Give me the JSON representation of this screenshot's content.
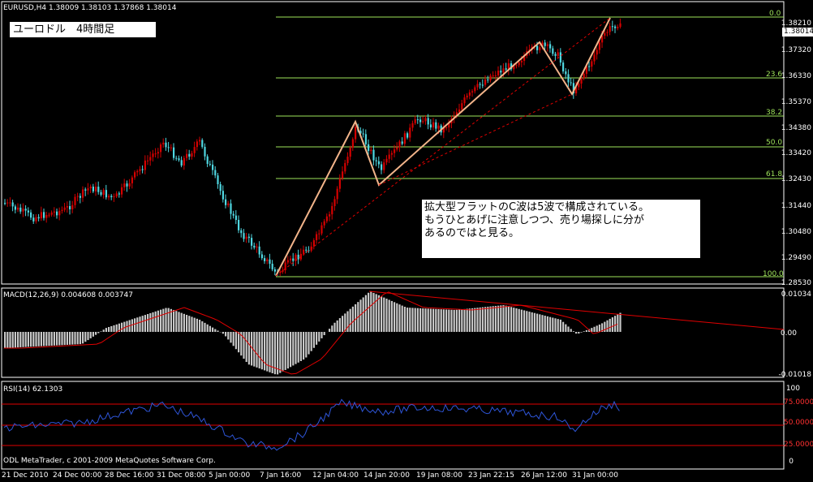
{
  "symbol_header": "EURUSD,H4  1.38009 1.38103 1.37868 1.38014",
  "title_label": "ユーロドル　4時間足",
  "annotation": {
    "line1": "拡大型フラットのC波は5波で構成されている。",
    "line2": "もうひとあげに注意しつつ、売り場探しに分が",
    "line3": "あるのではと見る。"
  },
  "price_axis": {
    "ticks": [
      "1.38210",
      "1.37320",
      "1.36330",
      "1.35370",
      "1.34380",
      "1.33420",
      "1.32430",
      "1.31440",
      "1.30480",
      "1.29490",
      "1.28530"
    ],
    "current_price": "1.38014"
  },
  "fibonacci_levels": [
    "0.0",
    "23.6",
    "38.2",
    "50.0",
    "61.8",
    "100.0"
  ],
  "macd": {
    "label": "MACD(12,26,9) 0.004608 0.003747",
    "axis_ticks": [
      "0.01034",
      "0.00",
      "-0.01018"
    ]
  },
  "rsi": {
    "label": "RSI(14) 62.1303",
    "axis_ticks": [
      "100",
      "0"
    ],
    "levels": [
      "75.0000",
      "50.0000",
      "25.0000"
    ]
  },
  "time_axis": [
    "21 Dec 2010",
    "24 Dec 00:00",
    "28 Dec 16:00",
    "31 Dec 08:00",
    "5 Jan 00:00",
    "7 Jan 16:00",
    "12 Jan 04:00",
    "14 Jan 20:00",
    "19 Jan 08:00",
    "23 Jan 22:15",
    "26 Jan 12:00",
    "31 Jan 00:00"
  ],
  "copyright": "ODL MetaTrader, c 2001-2009 MetaQuotes Software Corp.",
  "colors": {
    "bull_candle": "#d40000",
    "bear_candle": "#4fd6e0",
    "fib_line": "#9ee35a",
    "wave_line": "#f2b48a",
    "macd_signal": "#e00000",
    "macd_hist": "#c8c8c8",
    "rsi_line": "#2e55d8",
    "rsi_level": "#e00000",
    "grid": "#3a5a3a"
  }
}
